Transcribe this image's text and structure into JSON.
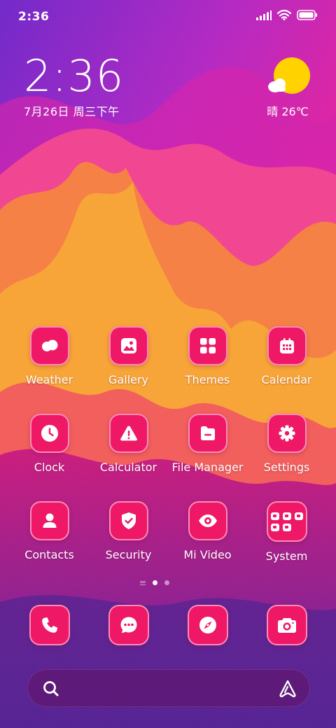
{
  "status_bar": {
    "time": "2:36",
    "signal_icon": "signal-icon",
    "wifi_icon": "wifi-icon",
    "battery_icon": "battery-icon"
  },
  "clock_widget": {
    "time": "2:36",
    "date": "7月26日 周三下午"
  },
  "weather_widget": {
    "icon": "sunny-partly-cloudy-icon",
    "text": "晴 26℃"
  },
  "apps": [
    {
      "label": "Weather",
      "icon": "weather-icon"
    },
    {
      "label": "Gallery",
      "icon": "gallery-icon"
    },
    {
      "label": "Themes",
      "icon": "themes-icon"
    },
    {
      "label": "Calendar",
      "icon": "calendar-icon"
    },
    {
      "label": "Clock",
      "icon": "clock-icon"
    },
    {
      "label": "Calculator",
      "icon": "calculator-icon"
    },
    {
      "label": "File Manager",
      "icon": "folder-icon"
    },
    {
      "label": "Settings",
      "icon": "gear-icon"
    },
    {
      "label": "Contacts",
      "icon": "contacts-icon"
    },
    {
      "label": "Security",
      "icon": "shield-icon"
    },
    {
      "label": "Mi Video",
      "icon": "eye-icon"
    },
    {
      "label": "System",
      "icon": "folder-grid-icon"
    }
  ],
  "page_indicator": {
    "pages": 2,
    "current": 1
  },
  "dock": [
    {
      "icon": "phone-icon"
    },
    {
      "icon": "messages-icon"
    },
    {
      "icon": "compass-icon"
    },
    {
      "icon": "camera-icon"
    }
  ],
  "search_bar": {
    "left_icon": "search-icon",
    "right_icon": "assistant-icon"
  },
  "colors": {
    "icon_bg": "#ee1866",
    "icon_border": "#ffa0c8",
    "sun": "#ffd200"
  }
}
